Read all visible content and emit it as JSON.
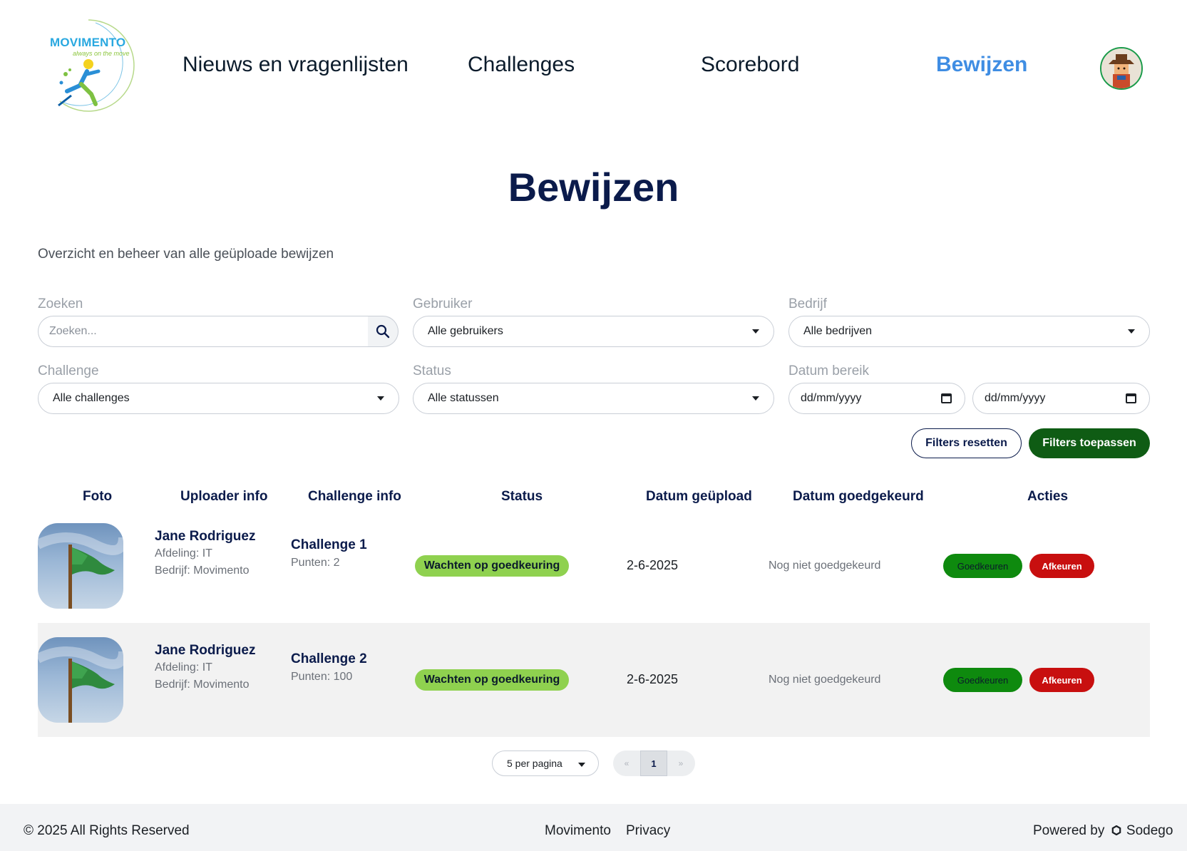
{
  "header": {
    "logo": {
      "name": "MOVIMENTO",
      "tagline": "always on the move"
    },
    "nav": [
      {
        "label": "Nieuws en vragenlijsten",
        "active": false
      },
      {
        "label": "Challenges",
        "active": false
      },
      {
        "label": "Scorebord",
        "active": false
      },
      {
        "label": "Bewijzen",
        "active": true
      }
    ]
  },
  "page": {
    "title": "Bewijzen",
    "subtitle": "Overzicht en beheer van alle geüploade bewijzen"
  },
  "filters": {
    "search": {
      "label": "Zoeken",
      "placeholder": "Zoeken..."
    },
    "user": {
      "label": "Gebruiker",
      "value": "Alle gebruikers"
    },
    "company": {
      "label": "Bedrijf",
      "value": "Alle bedrijven"
    },
    "challenge": {
      "label": "Challenge",
      "value": "Alle challenges"
    },
    "status": {
      "label": "Status",
      "value": "Alle statussen"
    },
    "date_range": {
      "label": "Datum bereik",
      "from": "dd/mm/yyyy",
      "to": "dd/mm/yyyy"
    },
    "reset_label": "Filters resetten",
    "apply_label": "Filters toepassen"
  },
  "table": {
    "columns": [
      "Foto",
      "Uploader info",
      "Challenge info",
      "Status",
      "Datum geüpload",
      "Datum goedgekeurd",
      "Acties"
    ],
    "rows": [
      {
        "name": "Jane Rodriguez",
        "department": "Afdeling: IT",
        "company": "Bedrijf: Movimento",
        "challenge": "Challenge 1",
        "points": "Punten: 2",
        "status": "Wachten op goedkeuring",
        "uploaded": "2-6-2025",
        "approved": "Nog niet goedgekeurd",
        "approve_label": "Goedkeuren",
        "reject_label": "Afkeuren"
      },
      {
        "name": "Jane Rodriguez",
        "department": "Afdeling: IT",
        "company": "Bedrijf: Movimento",
        "challenge": "Challenge 2",
        "points": "Punten: 100",
        "status": "Wachten op goedkeuring",
        "uploaded": "2-6-2025",
        "approved": "Nog niet goedgekeurd",
        "approve_label": "Goedkeuren",
        "reject_label": "Afkeuren"
      }
    ]
  },
  "pagination": {
    "per_page": "5 per pagina",
    "prev": "«",
    "current": "1",
    "next": "»"
  },
  "footer": {
    "copyright": "© 2025 All Rights Reserved",
    "links": [
      "Movimento",
      "Privacy"
    ],
    "powered_by": "Powered by",
    "powered_brand": "Sodego"
  },
  "colors": {
    "navy": "#0b1b4b",
    "active_nav": "#3f8de3",
    "apply_button": "#0f5c14",
    "status_badge": "#8fd14f",
    "approve_button": "#0e8a0e",
    "reject_button": "#c80f0f"
  },
  "icons": {
    "search": "search-icon",
    "dropdown": "chevron-down-icon",
    "calendar": "calendar-icon",
    "brand": "sodego-icon"
  }
}
